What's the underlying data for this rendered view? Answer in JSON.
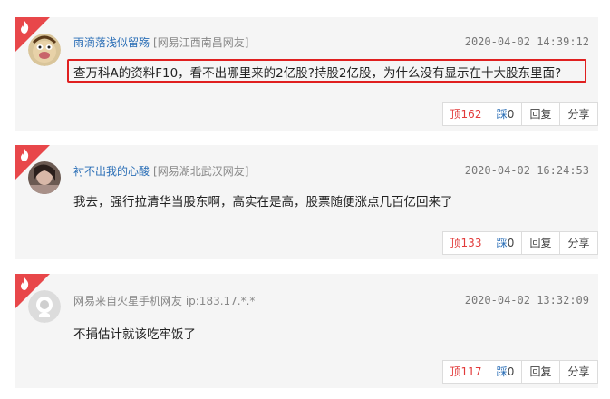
{
  "comments": [
    {
      "username": "雨滴落浅似留殇",
      "location": "[网易江西南昌网友]",
      "time": "2020-04-02 14:39:12",
      "content": "查万科A的资料F10，看不出哪里来的2亿股?持股2亿股，为什么没有显示在十大股东里面?",
      "up_label": "顶",
      "up_count": "162",
      "down_label": "踩",
      "down_count": "0",
      "reply_label": "回复",
      "share_label": "分享"
    },
    {
      "username": "衬不出我的心酸",
      "location": "[网易湖北武汉网友]",
      "time": "2020-04-02 16:24:53",
      "content": "我去，强行拉清华当股东啊，高实在是高，股票随便涨点几百亿回来了",
      "up_label": "顶",
      "up_count": "133",
      "down_label": "踩",
      "down_count": "0",
      "reply_label": "回复",
      "share_label": "分享"
    },
    {
      "username": "网易来自火星手机网友 ip:183.17.*.*",
      "location": "",
      "time": "2020-04-02 13:32:09",
      "content": "不捐估计就该吃牢饭了",
      "up_label": "顶",
      "up_count": "117",
      "down_label": "踩",
      "down_count": "0",
      "reply_label": "回复",
      "share_label": "分享"
    }
  ],
  "colors": {
    "accent_red": "#e8474a",
    "username_blue": "#2a6eb6",
    "highlight_border": "#e02020"
  }
}
